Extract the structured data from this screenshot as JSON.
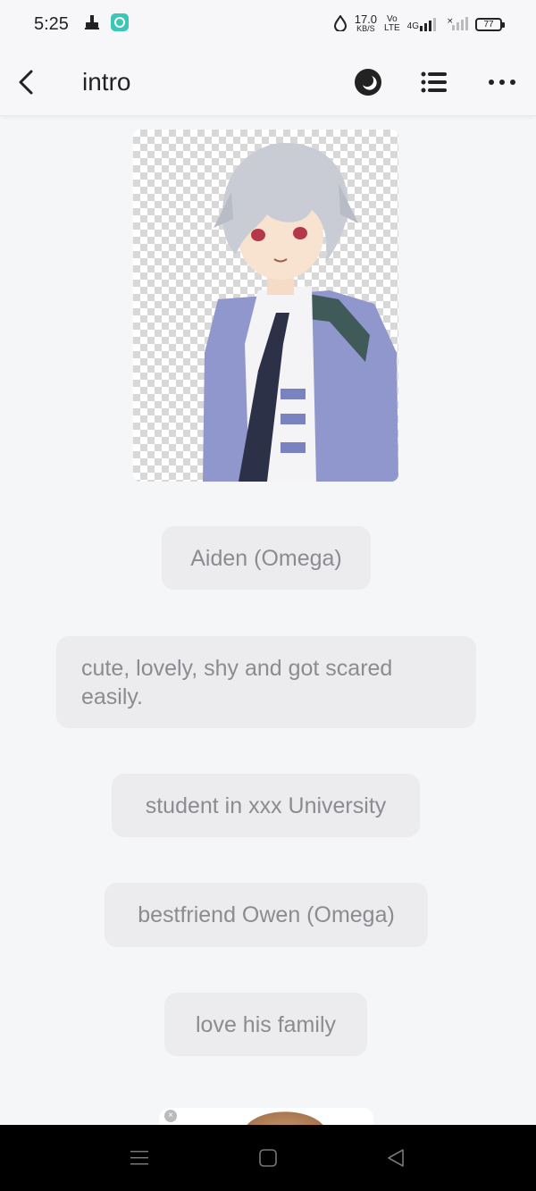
{
  "status_bar": {
    "time": "5:25",
    "net_speed_value": "17.0",
    "net_speed_unit": "KB/S",
    "volte_top": "Vo",
    "volte_bottom": "LTE",
    "network": "4G",
    "battery_level": "77"
  },
  "app_bar": {
    "title": "intro"
  },
  "content": {
    "bubbles": [
      {
        "text": "Aiden (Omega)"
      },
      {
        "text": "cute, lovely, shy and got scared easily."
      },
      {
        "text": "student in xxx University"
      },
      {
        "text": "bestfriend Owen (Omega)"
      },
      {
        "text": "love his family"
      }
    ]
  },
  "icons": {
    "back": "chevron-left-icon",
    "theme": "moon-icon",
    "list": "list-icon",
    "more": "more-horizontal-icon",
    "nav_menu": "menu-icon",
    "nav_home": "square-icon",
    "nav_back": "triangle-back-icon"
  },
  "colors": {
    "background": "#f5f6f8",
    "bubble_bg": "#ececef",
    "bubble_text": "#8c8c90",
    "nav_bar": "#000000"
  }
}
